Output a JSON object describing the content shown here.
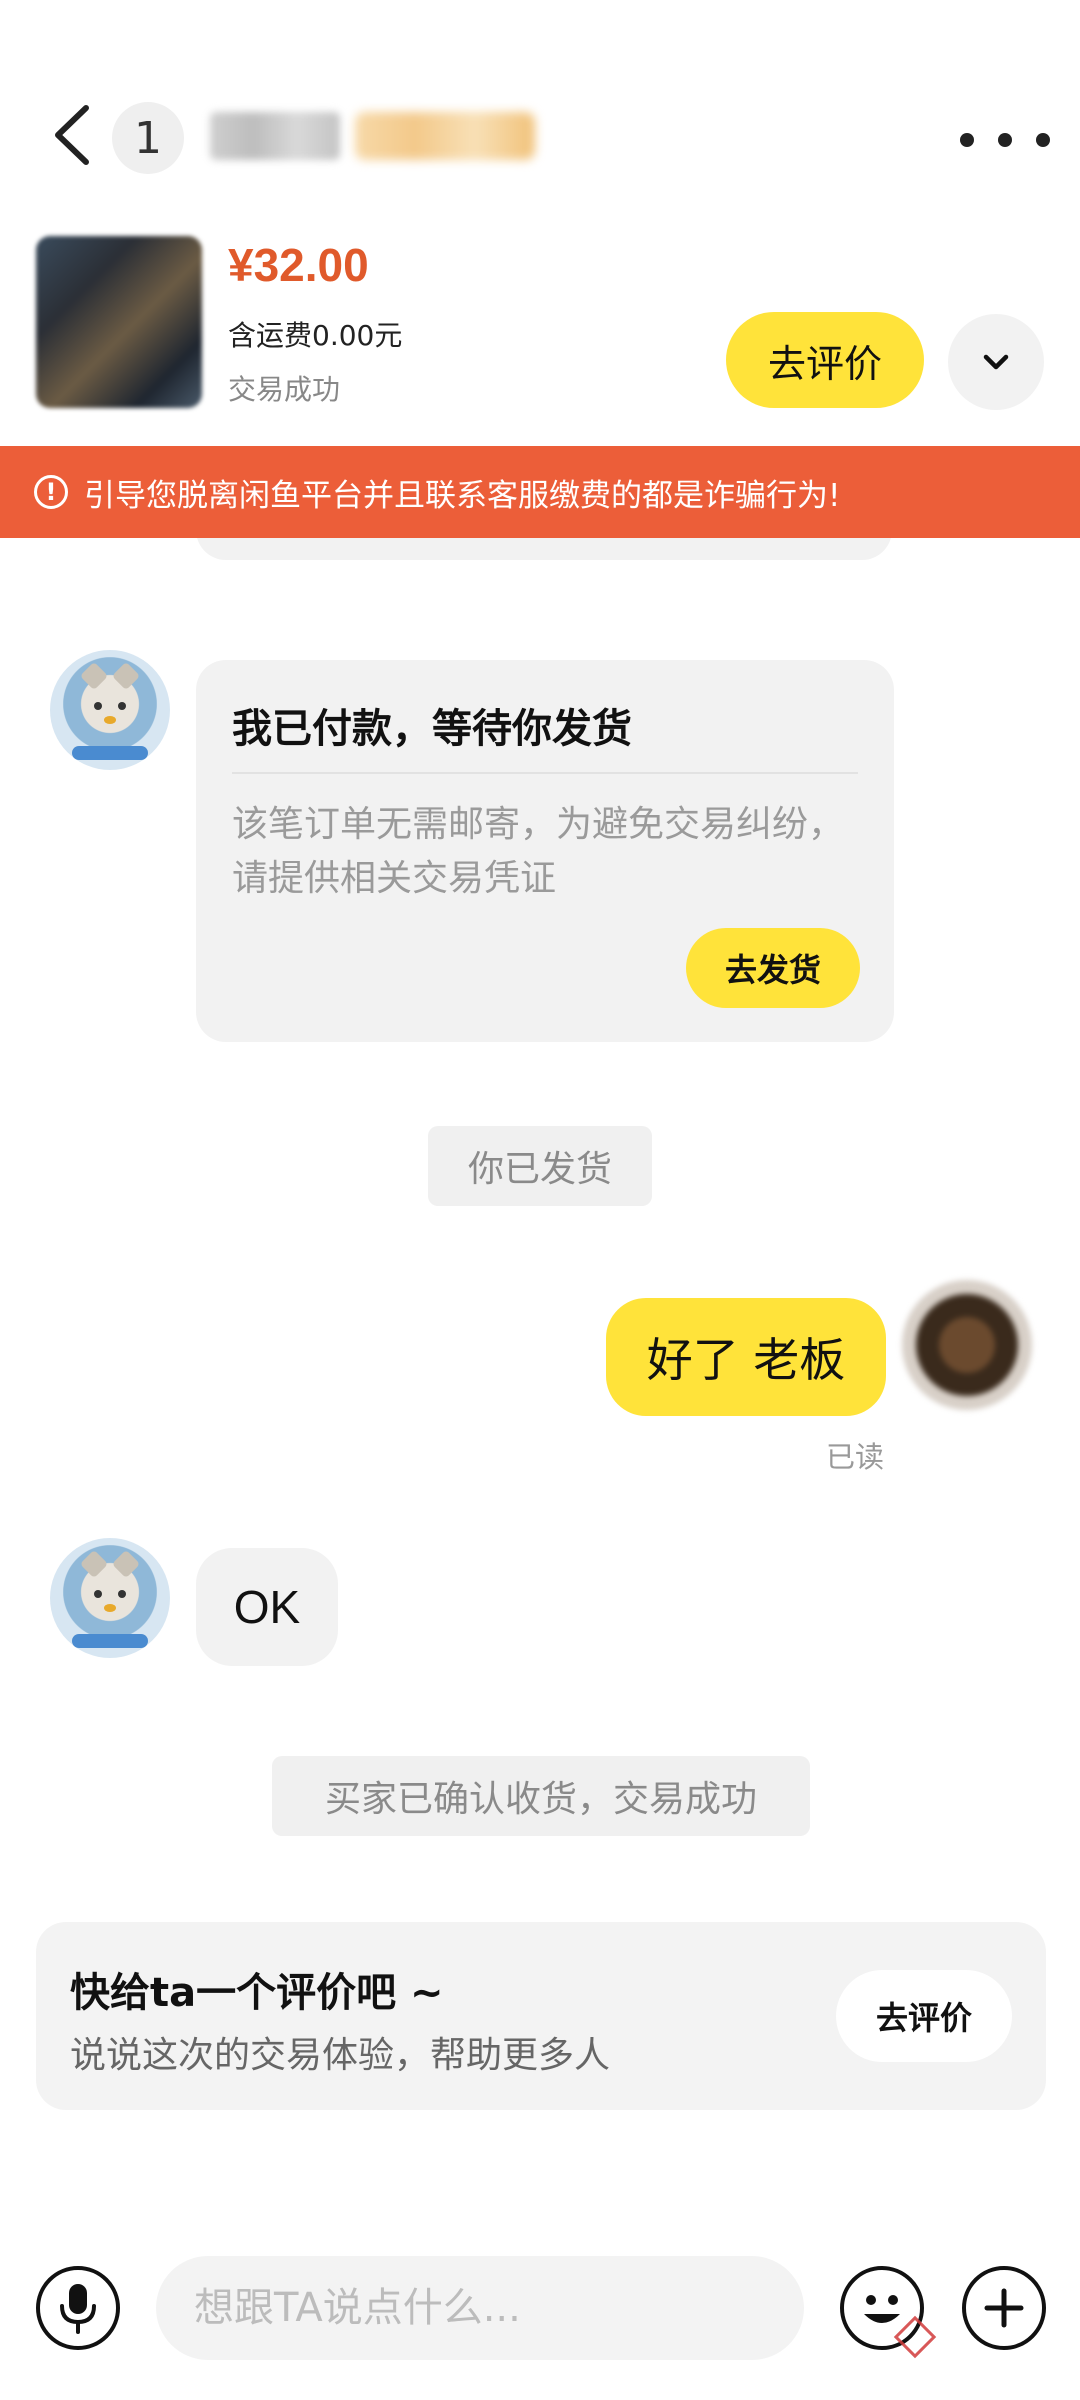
{
  "header": {
    "unread_count": "1"
  },
  "product": {
    "price": "¥32.00",
    "shipping": "含运费0.00元",
    "status": "交易成功",
    "review_button": "去评价"
  },
  "warning": {
    "text": "引导您脱离闲鱼平台并且联系客服缴费的都是诈骗行为!"
  },
  "messages": {
    "card": {
      "title": "我已付款，等待你发货",
      "body": "该笔订单无需邮寄，为避免交易纠纷，请提供相关交易凭证",
      "button": "去发货"
    },
    "system_shipped": "你已发货",
    "my_message": "好了 老板",
    "read_status": "已读",
    "reply": "OK",
    "system_confirmed": "买家已确认收货，交易成功"
  },
  "review_prompt": {
    "title": "快给ta一个评价吧 ~",
    "subtitle": "说说这次的交易体验，帮助更多人",
    "button": "去评价"
  },
  "input": {
    "placeholder": "想跟TA说点什么..."
  },
  "colors": {
    "accent_yellow": "#ffe33a",
    "warning_orange": "#ec5e39",
    "price_orange": "#e05a2b"
  }
}
